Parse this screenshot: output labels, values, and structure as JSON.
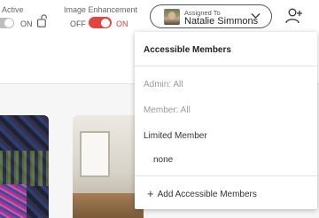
{
  "toolbar": {
    "active": {
      "label": "Active",
      "state_label": "ON"
    },
    "image_enhancement": {
      "label": "Image Enhancement",
      "off_label": "OFF",
      "on_label": "ON"
    },
    "assigned": {
      "label": "Assigned To",
      "name": "Natalie Simmons"
    },
    "add_user_icon": "person-add-icon"
  },
  "dropdown": {
    "title": "Accessible Members",
    "items": [
      {
        "label": "Admin: All"
      },
      {
        "label": "Member: All"
      },
      {
        "label": "Limited Member"
      },
      {
        "label": "none"
      }
    ],
    "add_label": "Add Accessible Members",
    "add_icon": "plus-icon"
  },
  "colors": {
    "toggle_on": "#e0463f",
    "toggle_off": "#bdbdbd",
    "muted_text": "#9a9a9a"
  }
}
